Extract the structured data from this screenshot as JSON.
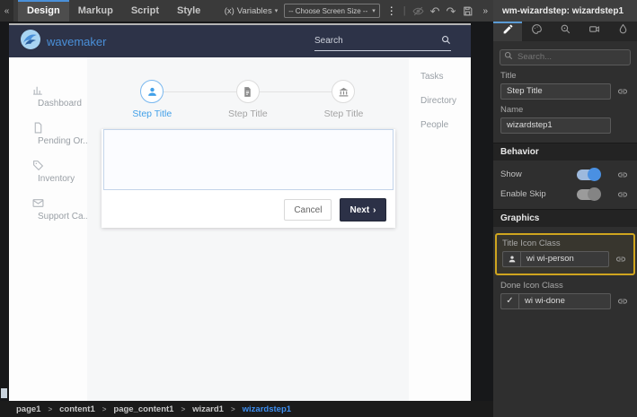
{
  "toolbar": {
    "collapse_icon": "«",
    "tabs": [
      {
        "label": "Design"
      },
      {
        "label": "Markup"
      },
      {
        "label": "Script"
      },
      {
        "label": "Style"
      }
    ],
    "variables_prefix": "(x)",
    "variables_label": "Variables",
    "variables_chevron": "▾",
    "screen_size": {
      "label": "-- Choose Screen Size --",
      "chevron": "▾"
    },
    "kebab_icon": "⋮",
    "divider": "|",
    "undo_icon": "↶",
    "redo_icon": "↷",
    "expand_icon": "»"
  },
  "panel": {
    "title": "wm-wizardstep: wizardstep1",
    "search_placeholder": "Search...",
    "title_field": {
      "label": "Title",
      "value": "Step Title"
    },
    "name_field": {
      "label": "Name",
      "value": "wizardstep1"
    },
    "behavior": {
      "heading": "Behavior",
      "show_label": "Show",
      "enable_skip_label": "Enable Skip"
    },
    "graphics": {
      "heading": "Graphics",
      "title_icon": {
        "label": "Title Icon Class",
        "value": "wi wi-person"
      },
      "done_icon": {
        "label": "Done Icon Class",
        "value": "wi wi-done",
        "glyph": "✓"
      }
    }
  },
  "canvas": {
    "brand": "wavemaker",
    "header_search_placeholder": "Search",
    "nav_items": [
      {
        "label": "Dashboard"
      },
      {
        "label": "Pending Or..."
      },
      {
        "label": "Inventory"
      },
      {
        "label": "Support Ca..."
      }
    ],
    "right_items": [
      {
        "label": "Tasks"
      },
      {
        "label": "Directory"
      },
      {
        "label": "People"
      }
    ],
    "wizard": {
      "steps": [
        {
          "title": "Step Title"
        },
        {
          "title": "Step Title"
        },
        {
          "title": "Step Title"
        }
      ],
      "cancel_label": "Cancel",
      "next_label": "Next",
      "next_arrow": "›"
    }
  },
  "breadcrumb": {
    "separator": ">",
    "items": [
      {
        "label": "page1"
      },
      {
        "label": "content1"
      },
      {
        "label": "page_content1"
      },
      {
        "label": "wizard1"
      },
      {
        "label": "wizardstep1"
      }
    ]
  },
  "colors": {
    "accent": "#4a90d9",
    "toggle_on": "#4a90e2",
    "highlight_border": "#cfa51f",
    "header_navy": "#2d3348",
    "next_button": "#2c3147",
    "active_step": "#42a0e8",
    "breadcrumb_current": "#3d8ef0"
  }
}
